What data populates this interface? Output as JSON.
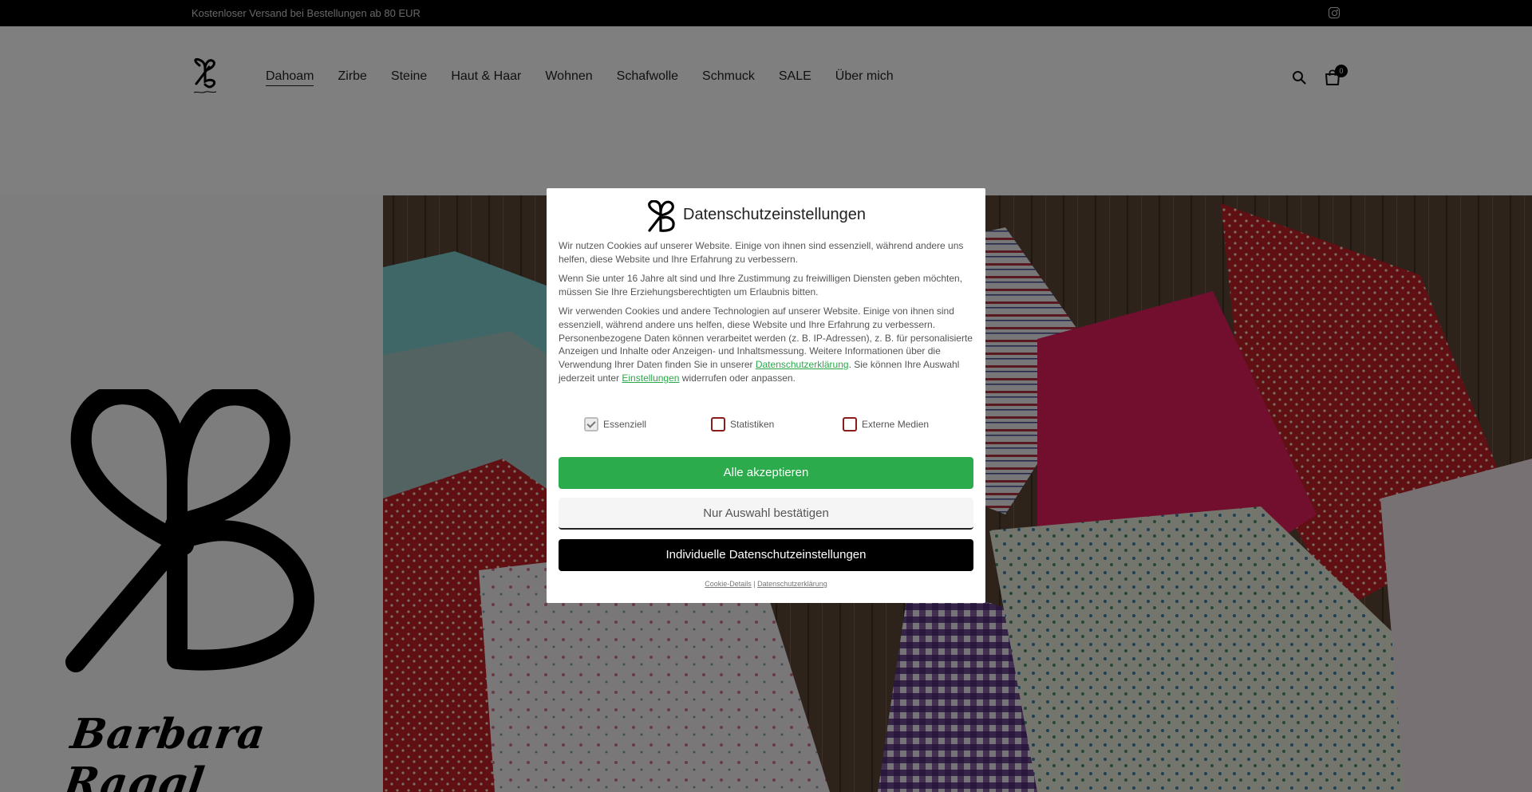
{
  "topbar": {
    "shipping_text": "Kostenloser Versand bei Bestellungen ab 80 EUR"
  },
  "header": {
    "nav": [
      "Dahoam",
      "Zirbe",
      "Steine",
      "Haut & Haar",
      "Wohnen",
      "Schafwolle",
      "Schmuck",
      "SALE",
      "Über mich"
    ],
    "active_nav": "Dahoam",
    "cart_count": "0"
  },
  "hero": {
    "signature": "Barbara Raggl"
  },
  "modal": {
    "title": "Datenschutzeinstellungen",
    "p1": "Wir nutzen Cookies auf unserer Website. Einige von ihnen sind essenziell, während andere uns helfen, diese Website und Ihre Erfahrung zu verbessern.",
    "p2": "Wenn Sie unter 16 Jahre alt sind und Ihre Zustimmung zu freiwilligen Diensten geben möchten, müssen Sie Ihre Erziehungsberechtigten um Erlaubnis bitten.",
    "p3_a": "Wir verwenden Cookies und andere Technologien auf unserer Website. Einige von ihnen sind essenziell, während andere uns helfen, diese Website und Ihre Erfahrung zu verbessern. Personenbezogene Daten können verarbeitet werden (z. B. IP-Adressen), z. B. für personalisierte Anzeigen und Inhalte oder Anzeigen- und Inhaltsmessung. Weitere Informationen über die Verwendung Ihrer Daten finden Sie in unserer",
    "p3_link1": "Datenschutzerklärung",
    "p3_b": ". Sie können Ihre Auswahl jederzeit unter",
    "p3_link2": "Einstellungen",
    "p3_c": "widerrufen oder anpassen.",
    "checkboxes": [
      {
        "label": "Essenziell",
        "checked": true,
        "disabled": true
      },
      {
        "label": "Statistiken",
        "checked": false
      },
      {
        "label": "Externe Medien",
        "checked": false
      }
    ],
    "accept_all": "Alle akzeptieren",
    "accept_selected": "Nur Auswahl bestätigen",
    "individual": "Individuelle Datenschutzeinstellungen",
    "link_cookie": "Cookie-Details",
    "link_sep": "|",
    "link_privacy": "Datenschutzerklärung"
  },
  "colors": {
    "accept_green": "#2bab4b",
    "link_green": "#2aa84a",
    "checkbox_red": "#8a1c1c"
  }
}
